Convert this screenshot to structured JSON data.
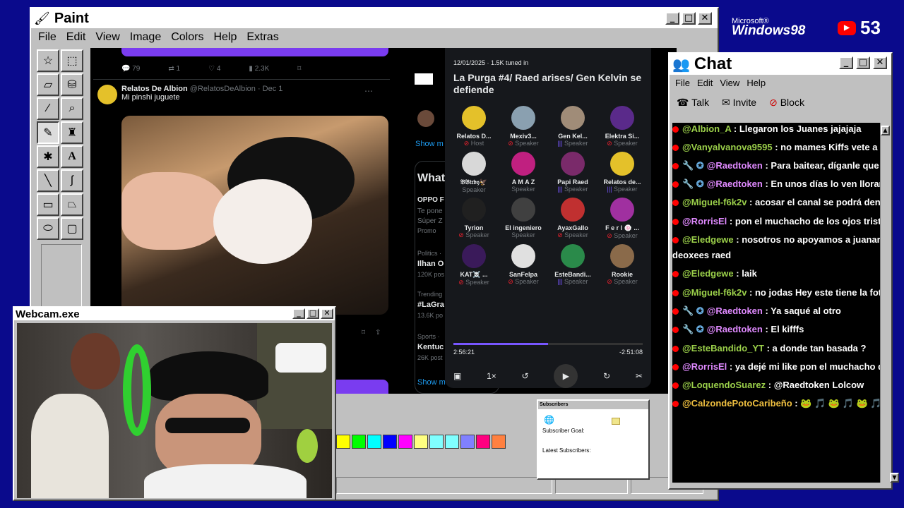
{
  "paint": {
    "title": "Paint",
    "menu": [
      "File",
      "Edit",
      "View",
      "Image",
      "Colors",
      "Help",
      "Extras"
    ],
    "palette": [
      "#ffff00",
      "#00ff00",
      "#00ffff",
      "#0000ff",
      "#ff00ff",
      "#ffff80",
      "#80ffff",
      "#80ffff",
      "#8080ff",
      "#ff0080",
      "#ff8040"
    ]
  },
  "feed": {
    "stats1": {
      "replies": "79",
      "retweets": "1",
      "likes": "4",
      "views": "2.3K"
    },
    "tweet": {
      "name": "Relatos De Albion",
      "handle": "@RelatosDeAlbion · Dec 1",
      "text": "Mi pinshi juguete"
    }
  },
  "trending": {
    "show_more": "Show m",
    "whats": "What",
    "promo_title": "OPPO F",
    "promo_l1": "Te pone",
    "promo_l2": "Súper Z",
    "promo_l3": "Promo",
    "t1_cat": "Politics ·",
    "t1_name": "Ilhan O",
    "t1_posts": "120K pos",
    "t2_cat": "Trending",
    "t2_name": "#LaGra",
    "t2_posts": "13.6K po",
    "t3_cat": "Sports ·",
    "t3_name": "Kentuc",
    "t3_posts": "26K post",
    "show_more2": "Show m"
  },
  "spaces": {
    "meta": "12/01/2025 · 1.5K tuned in",
    "title": "La Purga #4/ Raed arises/ Gen Kelvin se defiende",
    "participants": [
      {
        "name": "Relatos D...",
        "role": "Host",
        "kind": "host",
        "color": "#e4c12a"
      },
      {
        "name": "Mexiv3...",
        "role": "Speaker",
        "kind": "mut",
        "color": "#8aa0b0"
      },
      {
        "name": "Gen Kel...",
        "role": "Speaker",
        "kind": "live",
        "color": "#a08c78"
      },
      {
        "name": "Elektra Si...",
        "role": "Speaker",
        "kind": "mut",
        "color": "#5a2a8a"
      },
      {
        "name": "𝔅𝔅𝔦𝔯𝔡𝔶🦅",
        "role": "Speaker",
        "kind": "none",
        "color": "#d8d8d8"
      },
      {
        "name": "A M A Z",
        "role": "Speaker",
        "kind": "none",
        "color": "#c02080"
      },
      {
        "name": "Papi Raed",
        "role": "Speaker",
        "kind": "live",
        "color": "#7a2a6a"
      },
      {
        "name": "Relatos de...",
        "role": "Speaker",
        "kind": "live",
        "color": "#e4c12a"
      },
      {
        "name": "Tyrion",
        "role": "Speaker",
        "kind": "mut",
        "color": "#202020"
      },
      {
        "name": "El ingeniero",
        "role": "Speaker",
        "kind": "none",
        "color": "#404040"
      },
      {
        "name": "AyaxGallo",
        "role": "Speaker",
        "kind": "mut",
        "color": "#c03030"
      },
      {
        "name": "F e r l 🍥 ...",
        "role": "Speaker",
        "kind": "mut",
        "color": "#a030a0"
      },
      {
        "name": "KAT☠️ ...",
        "role": "Speaker",
        "kind": "mut",
        "color": "#3a1a5a"
      },
      {
        "name": "SanFelpa",
        "role": "Speaker",
        "kind": "mut",
        "color": "#e0e0e0"
      },
      {
        "name": "EsteBandi...",
        "role": "Speaker",
        "kind": "live",
        "color": "#2a8a4a"
      },
      {
        "name": "Rookie",
        "role": "Speaker",
        "kind": "mut",
        "color": "#8a6a4a"
      }
    ],
    "elapsed": "2:56:21",
    "remaining": "-2:51:08",
    "progress": 0.5,
    "speed": "1×"
  },
  "subscribers": {
    "title": "Subscribers",
    "goal": "Subscriber Goal:",
    "latest": "Latest Subscribers:"
  },
  "chat": {
    "title": "Chat",
    "menu": [
      "File",
      "Edit",
      "View",
      "Help"
    ],
    "tools": [
      "Talk",
      "Invite",
      "Block"
    ],
    "messages": [
      {
        "user": "@Albion_A",
        "text": "Llegaron los Juanes jajajaja",
        "color": "#9bd04a",
        "badges": ""
      },
      {
        "user": "@Vanyalvanova9595",
        "text": "no mames Kiffs vete a baí",
        "color": "#9bd04a",
        "badges": ""
      },
      {
        "user": "@Raedtoken",
        "text": "Para baitear, díganle que ya lo",
        "color": "#e08aff",
        "badges": "🔧 ✪"
      },
      {
        "user": "@Raedtoken",
        "text": "En unos días lo ven llorando c",
        "color": "#e08aff",
        "badges": "🔧 ✪"
      },
      {
        "user": "@Miguel-f6k2v",
        "text": "acosar el canal se podrá denunc",
        "color": "#9bd04a",
        "badges": ""
      },
      {
        "user": "@RorrisEl",
        "text": "pon el muchacho de los ojos tristes",
        "color": "#e08aff",
        "badges": ""
      },
      {
        "user": "@Eledgewe",
        "text": "nosotros no apoyamos a juanarka, c",
        "color": "#9bd04a",
        "badges": ""
      },
      {
        "user": "",
        "text": "deoxees raed",
        "color": "#ffffff",
        "badges": ""
      },
      {
        "user": "@Eledgewe",
        "text": "laik",
        "color": "#9bd04a",
        "badges": ""
      },
      {
        "user": "@Miguel-f6k2v",
        "text": "no jodas Hey este tiene la foto d",
        "color": "#9bd04a",
        "badges": ""
      },
      {
        "user": "@Raedtoken",
        "text": "Ya saqué al otro",
        "color": "#e08aff",
        "badges": "🔧 ✪"
      },
      {
        "user": "@Raedtoken",
        "text": "El kifffs",
        "color": "#e08aff",
        "badges": "🔧 ✪"
      },
      {
        "user": "@EsteBandido_YT",
        "text": "a donde tan basada ?",
        "color": "#9bd04a",
        "badges": ""
      },
      {
        "user": "@RorrisEl",
        "text": "ya dejé mi like pon el muchacho de lo",
        "color": "#e08aff",
        "badges": ""
      },
      {
        "user": "@LoquendoSuarez",
        "text": "@Raedtoken Lolcow",
        "color": "#9bd04a",
        "badges": ""
      },
      {
        "user": "@CalzondePotoCaribeño",
        "text": "🐸 🎵 🐸 🎵 🐸 🎵",
        "color": "#f0c040",
        "badges": ""
      }
    ]
  },
  "webcam": {
    "title": "Webcam.exe"
  },
  "brand": {
    "microsoft": "Microsoft®",
    "windows": "Windows98"
  },
  "youtube": {
    "count": "53"
  }
}
